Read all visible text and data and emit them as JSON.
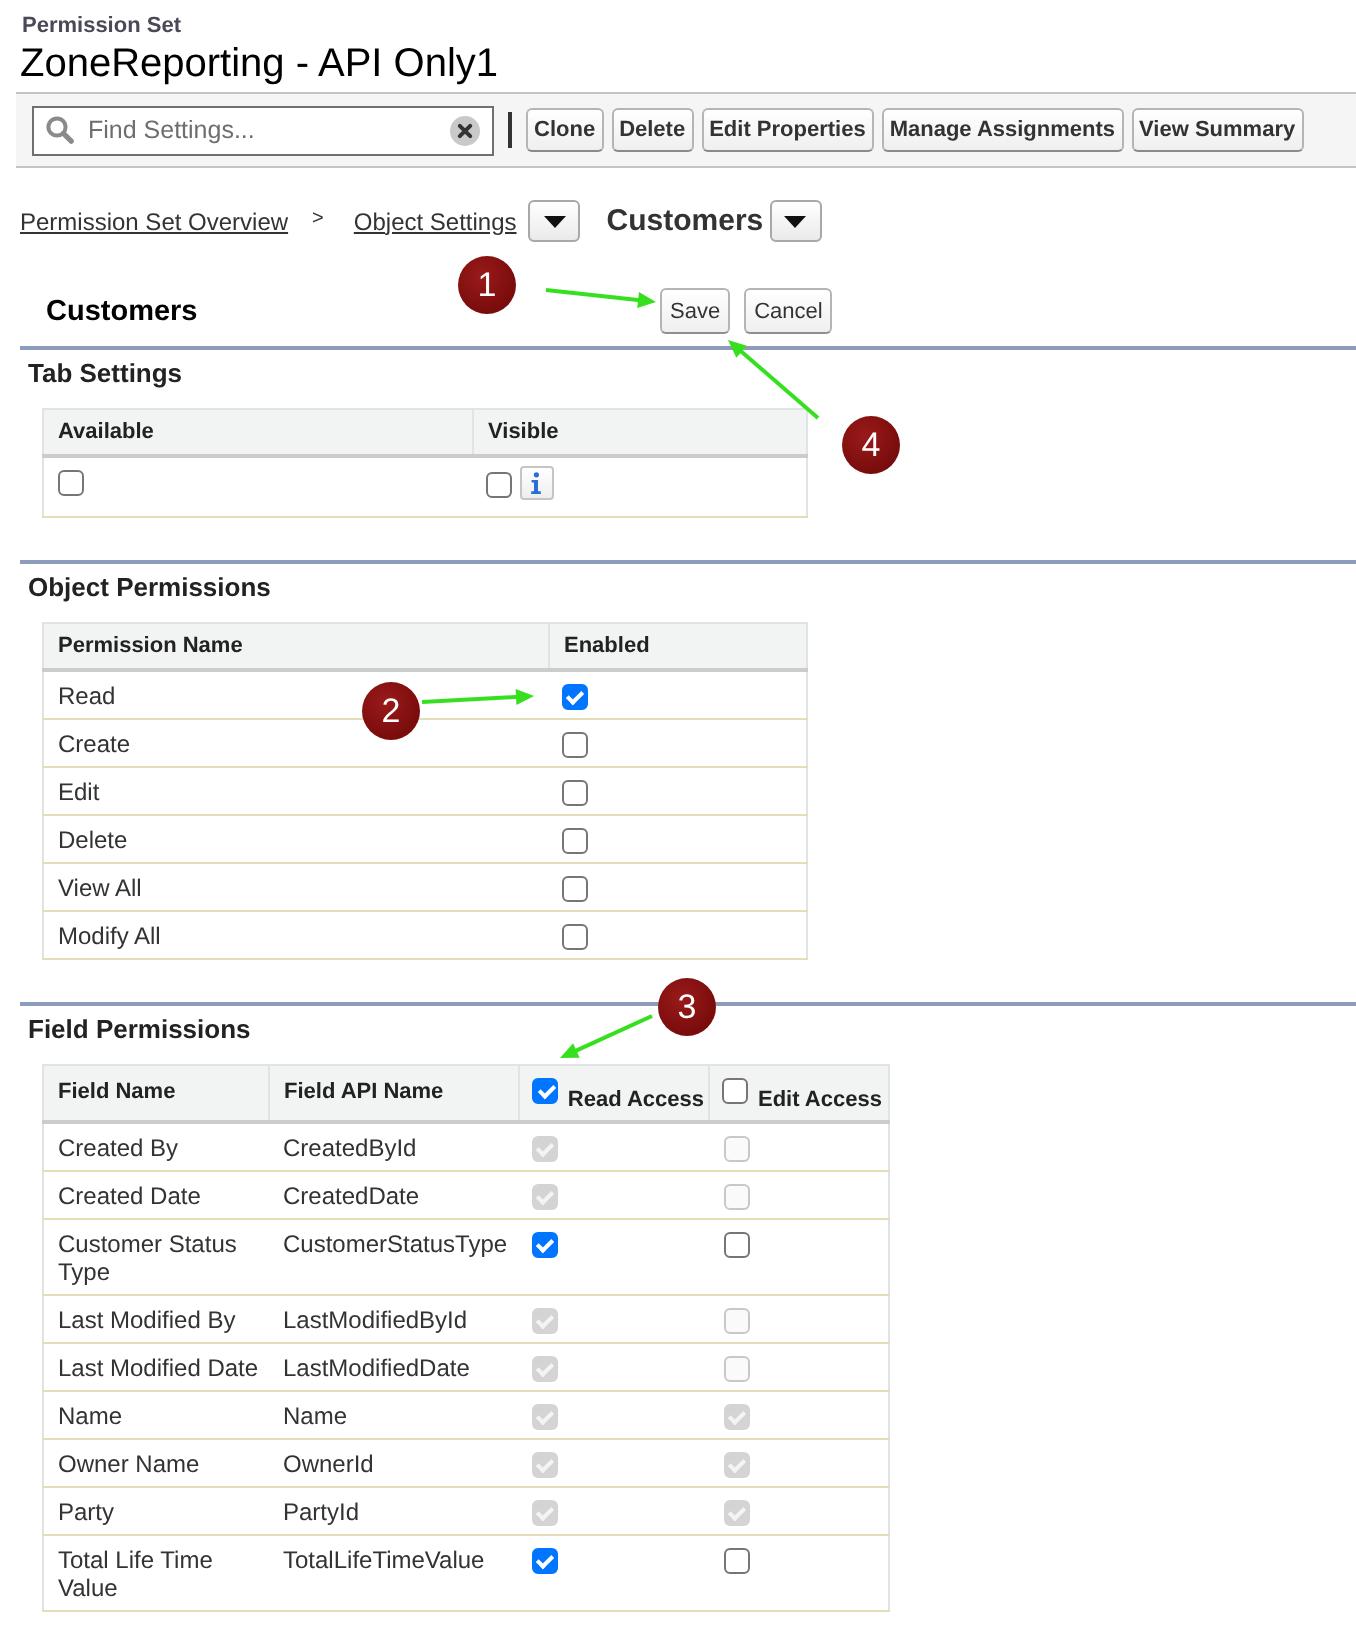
{
  "header": {
    "caption": "Permission Set",
    "title": "ZoneReporting - API Only1"
  },
  "toolbar": {
    "search": {
      "placeholder": "Find Settings..."
    },
    "buttons": [
      "Clone",
      "Delete",
      "Edit Properties",
      "Manage Assignments",
      "View Summary"
    ]
  },
  "breadcrumb": {
    "items": [
      {
        "kind": "link",
        "label": "Permission Set Overview",
        "menu": false
      },
      {
        "kind": "separator",
        "label": ">",
        "menu": false
      },
      {
        "kind": "link",
        "label": "Object Settings",
        "menu": true
      },
      {
        "kind": "current",
        "label": "Customers",
        "menu": true
      }
    ]
  },
  "edit_block": {
    "title": "Customers",
    "buttons": [
      "Save",
      "Cancel"
    ]
  },
  "tab_settings": {
    "title": "Tab Settings",
    "columns": [
      "Available",
      "Visible"
    ],
    "available": {
      "checked": false
    },
    "visible": {
      "checked": false
    }
  },
  "object_permissions": {
    "title": "Object Permissions",
    "columns": [
      "Permission Name",
      "Enabled"
    ],
    "rows": [
      {
        "name": "Read",
        "enabled": true
      },
      {
        "name": "Create",
        "enabled": false
      },
      {
        "name": "Edit",
        "enabled": false
      },
      {
        "name": "Delete",
        "enabled": false
      },
      {
        "name": "View All",
        "enabled": false
      },
      {
        "name": "Modify All",
        "enabled": false
      }
    ]
  },
  "field_permissions": {
    "title": "Field Permissions",
    "columns": [
      {
        "kind": "text",
        "label": "Field Name"
      },
      {
        "kind": "text",
        "label": "Field API Name"
      },
      {
        "kind": "checkbox",
        "label": "Read Access",
        "checked": true
      },
      {
        "kind": "checkbox",
        "label": "Edit Access",
        "checked": false
      }
    ],
    "rows": [
      {
        "field_name": "Created By",
        "api_name": "CreatedById",
        "read": {
          "checked": true,
          "disabled": true
        },
        "edit": {
          "checked": false,
          "disabled": true
        }
      },
      {
        "field_name": "Created Date",
        "api_name": "CreatedDate",
        "read": {
          "checked": true,
          "disabled": true
        },
        "edit": {
          "checked": false,
          "disabled": true
        }
      },
      {
        "field_name": "Customer Status Type",
        "api_name": "CustomerStatusType",
        "read": {
          "checked": true,
          "disabled": false
        },
        "edit": {
          "checked": false,
          "disabled": false
        }
      },
      {
        "field_name": "Last Modified By",
        "api_name": "LastModifiedById",
        "read": {
          "checked": true,
          "disabled": true
        },
        "edit": {
          "checked": false,
          "disabled": true
        }
      },
      {
        "field_name": "Last Modified Date",
        "api_name": "LastModifiedDate",
        "read": {
          "checked": true,
          "disabled": true
        },
        "edit": {
          "checked": false,
          "disabled": true
        }
      },
      {
        "field_name": "Name",
        "api_name": "Name",
        "read": {
          "checked": true,
          "disabled": true
        },
        "edit": {
          "checked": true,
          "disabled": true
        }
      },
      {
        "field_name": "Owner Name",
        "api_name": "OwnerId",
        "read": {
          "checked": true,
          "disabled": true
        },
        "edit": {
          "checked": true,
          "disabled": true
        }
      },
      {
        "field_name": "Party",
        "api_name": "PartyId",
        "read": {
          "checked": true,
          "disabled": true
        },
        "edit": {
          "checked": true,
          "disabled": true
        }
      },
      {
        "field_name": "Total Life Time Value",
        "api_name": "TotalLifeTimeValue",
        "read": {
          "checked": true,
          "disabled": false
        },
        "edit": {
          "checked": false,
          "disabled": false
        }
      }
    ]
  },
  "annotations": [
    {
      "number": "1"
    },
    {
      "number": "2"
    },
    {
      "number": "3"
    },
    {
      "number": "4"
    }
  ]
}
